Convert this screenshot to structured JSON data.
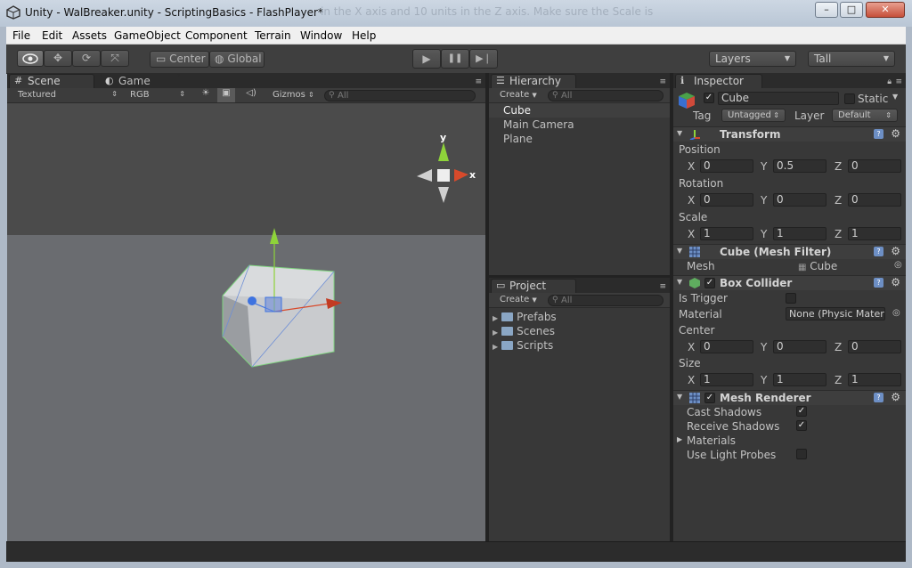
{
  "window": {
    "title": "Unity - WalBreaker.unity - ScriptingBasics - FlashPlayer*",
    "ghost_text": "in the X axis and 10 units in the Z axis. Make sure the Scale is",
    "minimize": "–",
    "maximize": "□",
    "close": "✕"
  },
  "menu": {
    "items": [
      {
        "label": "File"
      },
      {
        "label": "Edit"
      },
      {
        "label": "Assets"
      },
      {
        "label": "GameObject"
      },
      {
        "label": "Component"
      },
      {
        "label": "Terrain"
      },
      {
        "label": "Window"
      },
      {
        "label": "Help"
      }
    ]
  },
  "toolbar": {
    "center_label": "Center",
    "global_label": "Global",
    "layers_label": "Layers",
    "layout_label": "Tall",
    "play_icon": "▶",
    "pause_icon": "❚❚",
    "step_icon": "▶❘"
  },
  "scene": {
    "tab_label": "Scene",
    "game_tab_label": "Game",
    "render_mode": "Textured",
    "color_mode": "RGB",
    "gizmos_label": "Gizmos",
    "search_placeholder": "All",
    "axis_y": "y",
    "axis_x": "x"
  },
  "hierarchy": {
    "tab_label": "Hierarchy",
    "create_label": "Create",
    "search_placeholder": "All",
    "items": [
      "Cube",
      "Main Camera",
      "Plane"
    ],
    "selected": "Cube"
  },
  "project": {
    "tab_label": "Project",
    "create_label": "Create",
    "search_placeholder": "All",
    "folders": [
      "Prefabs",
      "Scenes",
      "Scripts"
    ]
  },
  "inspector": {
    "tab_label": "Inspector",
    "object_name": "Cube",
    "static_label": "Static",
    "tag_label": "Tag",
    "tag_value": "Untagged",
    "layer_label": "Layer",
    "layer_value": "Default",
    "transform": {
      "title": "Transform",
      "position_label": "Position",
      "rotation_label": "Rotation",
      "scale_label": "Scale",
      "position": {
        "x": "0",
        "y": "0.5",
        "z": "0"
      },
      "rotation": {
        "x": "0",
        "y": "0",
        "z": "0"
      },
      "scale": {
        "x": "1",
        "y": "1",
        "z": "1"
      }
    },
    "mesh_filter": {
      "title": "Cube (Mesh Filter)",
      "mesh_label": "Mesh",
      "mesh_value": "Cube"
    },
    "box_collider": {
      "title": "Box Collider",
      "is_trigger_label": "Is Trigger",
      "material_label": "Material",
      "material_value": "None (Physic Mater",
      "center_label": "Center",
      "size_label": "Size",
      "center": {
        "x": "0",
        "y": "0",
        "z": "0"
      },
      "size": {
        "x": "1",
        "y": "1",
        "z": "1"
      }
    },
    "mesh_renderer": {
      "title": "Mesh Renderer",
      "cast_shadows_label": "Cast Shadows",
      "receive_shadows_label": "Receive Shadows",
      "materials_label": "Materials",
      "light_probes_label": "Use Light Probes"
    },
    "axis_labels": {
      "x": "X",
      "y": "Y",
      "z": "Z"
    }
  },
  "colors": {
    "editor_bg": "#383838",
    "title_bar": "#c5d0de",
    "gizmo_x": "#d84a2b",
    "gizmo_y": "#8ed33a",
    "gizmo_z": "#3e73e0"
  }
}
